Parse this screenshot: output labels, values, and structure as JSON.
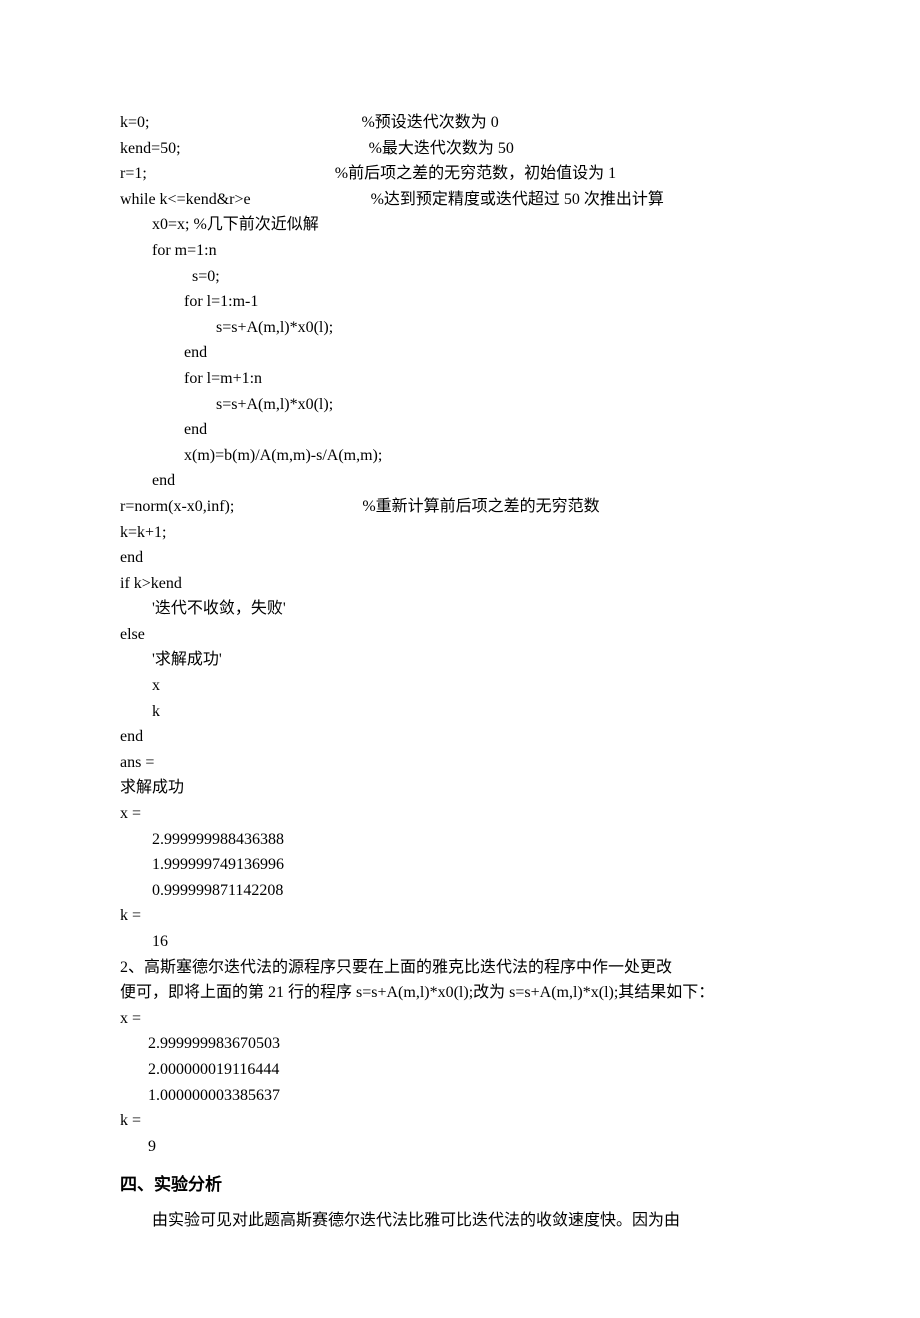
{
  "code_lines": [
    "k=0;                                                     %预设迭代次数为 0",
    "kend=50;                                               %最大迭代次数为 50",
    "r=1;                                               %前后项之差的无穷范数，初始值设为 1",
    "while k<=kend&r>e                              %达到预定精度或迭代超过 50 次推出计算",
    "        x0=x; %几下前次近似解",
    "        for m=1:n",
    "                  s=0;",
    "                for l=1:m-1",
    "                        s=s+A(m,l)*x0(l);",
    "                end",
    "                for l=m+1:n",
    "                        s=s+A(m,l)*x0(l);",
    "                end",
    "                x(m)=b(m)/A(m,m)-s/A(m,m);",
    "        end",
    "r=norm(x-x0,inf);                                %重新计算前后项之差的无穷范数",
    "k=k+1;",
    "end",
    "if k>kend",
    "        '迭代不收敛，失败'",
    "else",
    "        '求解成功'",
    "        x",
    "        k",
    "end",
    "ans =",
    "求解成功",
    "x =",
    "        2.999999988436388",
    "        1.999999749136996",
    "        0.999999871142208",
    "k =",
    "        16",
    "2、高斯塞德尔迭代法的源程序只要在上面的雅克比迭代法的程序中作一处更改",
    "便可，即将上面的第 21 行的程序 s=s+A(m,l)*x0(l);改为 s=s+A(m,l)*x(l);其结果如下：",
    "x =",
    "       2.999999983670503",
    "       2.000000019116444",
    "       1.000000003385637",
    "k =",
    "       9"
  ],
  "heading": "四、实验分析",
  "para1": "由实验可见对此题高斯赛德尔迭代法比雅可比迭代法的收敛速度快。因为由"
}
